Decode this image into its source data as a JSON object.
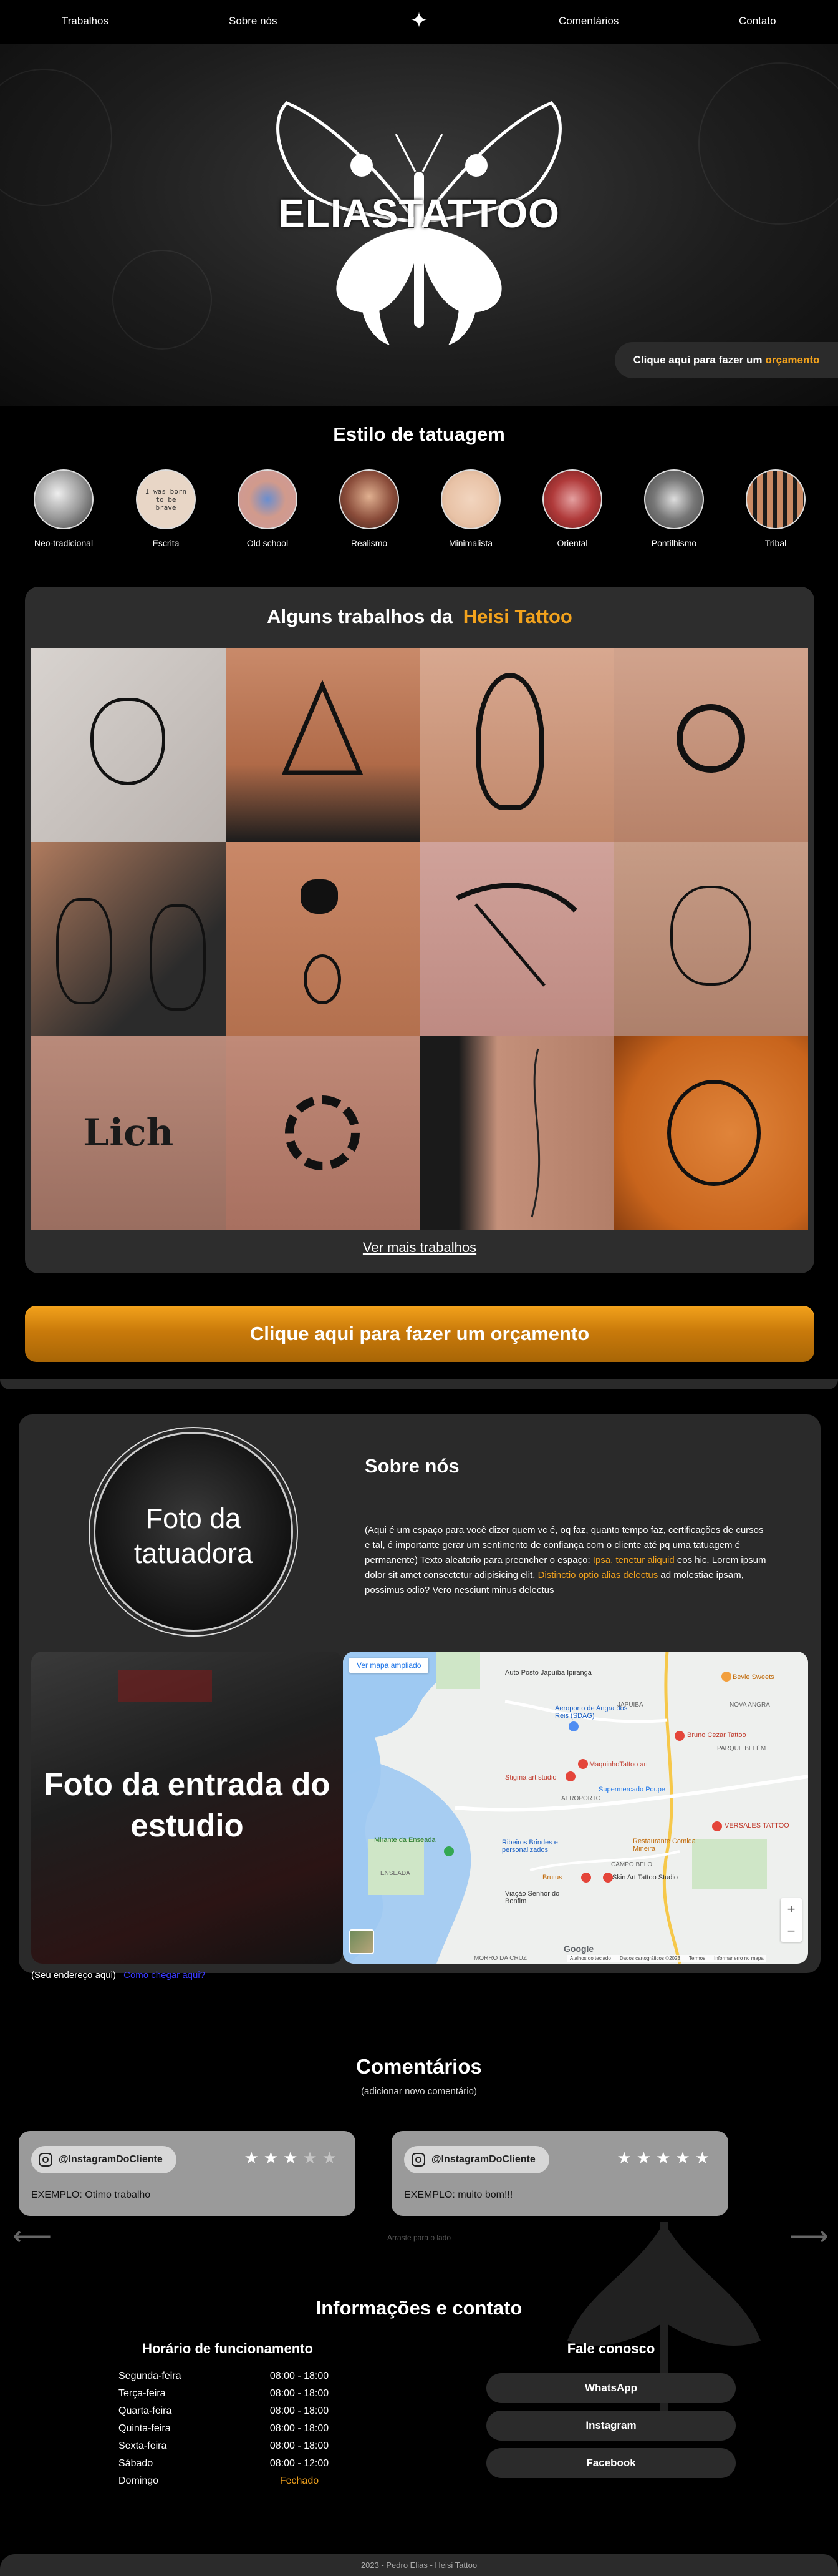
{
  "nav": {
    "items": [
      "Trabalhos",
      "Sobre nós",
      "Comentários",
      "Contato"
    ],
    "center_icon": "sparkle-star-icon"
  },
  "hero": {
    "logo_text": "ELIASTATTOO",
    "cta_prefix": "Clique aqui para fazer um",
    "cta_highlight": "orçamento"
  },
  "styles": {
    "title": "Estilo de tatuagem",
    "items": [
      "Neo-tradicional",
      "Escrita",
      "Old school",
      "Realismo",
      "Minimalista",
      "Oriental",
      "Pontilhismo",
      "Tribal"
    ],
    "escrita_sample": "I was born to be brave"
  },
  "gallery": {
    "title_prefix": "Alguns trabalhos da",
    "title_highlight": "Heisi Tattoo",
    "tile_text_lich": "Lich",
    "more_link": "Ver mais trabalhos"
  },
  "big_cta": {
    "label": "Clique aqui para fazer um orçamento"
  },
  "about": {
    "photo_placeholder": "Foto da tatuadora",
    "title": "Sobre nós",
    "text_part1": "(Aqui é um espaço para você dizer quem vc é, oq faz, quanto tempo faz, certificações de cursos e tal, é importante gerar um sentimento de confiança com o cliente até pq uma tatuagem é permanente) Texto aleatorio para preencher o espaço: ",
    "text_highlight1": "Ipsa, tenetur aliquid",
    "text_part2": " eos hic. Lorem ipsum dolor sit amet consectetur adipisicing elit. ",
    "text_highlight2": "Distinctio optio alias delectus",
    "text_part3": " ad molestiae ipsam, possimus odio? Vero nesciunt minus delectus",
    "entrance_placeholder": "Foto da entrada do estudio",
    "address_label": "(Seu endereço aqui)",
    "address_link": "Como chegar aqui?"
  },
  "map": {
    "expand_link": "Ver mapa ampliado",
    "labels": [
      "Auto Posto Japuíba Ipiranga",
      "Bevie Sweets",
      "Aeroporto de Angra dos Reis (SDAG)",
      "Bruno Cezar Tattoo",
      "MaquinhoTattoo art",
      "Stigma art studio",
      "Supermercado Poupe",
      "VERSALES TATTOO",
      "Mirante da Enseada",
      "Ribeiros Brindes e personalizados",
      "Restaurante Comida Mineira",
      "Brutus",
      "Skin Art Tattoo Studio",
      "Viação Senhor do Bonfim",
      "JAPUIBA",
      "AEROPORTO",
      "CAMPO BELO",
      "ENSEADA",
      "MORRO DA CRUZ",
      "PARQUE BELÉM",
      "NOVA ANGRA"
    ],
    "attribution": [
      "Atalhos do teclado",
      "Dados cartográficos ©2023",
      "Termos",
      "Informar erro no mapa"
    ],
    "google": "Google",
    "zoom_in": "+",
    "zoom_out": "−"
  },
  "comments": {
    "title": "Comentários",
    "add_link": "(adicionar novo comentário)",
    "items": [
      {
        "handle": "@InstagramDoCliente",
        "rating": 3,
        "max": 5,
        "text": "EXEMPLO: Otimo trabalho"
      },
      {
        "handle": "@InstagramDoCliente",
        "rating": 5,
        "max": 5,
        "text": "EXEMPLO: muito bom!!!"
      }
    ],
    "swipe_hint": "Arraste para o lado",
    "prev_icon": "arrow-left-icon",
    "next_icon": "arrow-right-icon"
  },
  "contact": {
    "title": "Informações e contato",
    "hours_title": "Horário de funcionamento",
    "hours": [
      {
        "day": "Segunda-feira",
        "time": "08:00 - 18:00"
      },
      {
        "day": "Terça-feira",
        "time": "08:00 - 18:00"
      },
      {
        "day": "Quarta-feira",
        "time": "08:00 - 18:00"
      },
      {
        "day": "Quinta-feira",
        "time": "08:00 - 18:00"
      },
      {
        "day": "Sexta-feira",
        "time": "08:00 - 18:00"
      },
      {
        "day": "Sábado",
        "time": "08:00 - 12:00"
      },
      {
        "day": "Domingo",
        "time": "Fechado"
      }
    ],
    "talk_title": "Fale conosco",
    "buttons": [
      "WhatsApp",
      "Instagram",
      "Facebook"
    ]
  },
  "footer": {
    "text": "2023 - Pedro Elias - Heisi Tattoo"
  },
  "colors": {
    "accent": "#f2a21d",
    "card": "#2d2d2d",
    "background": "#000000"
  }
}
